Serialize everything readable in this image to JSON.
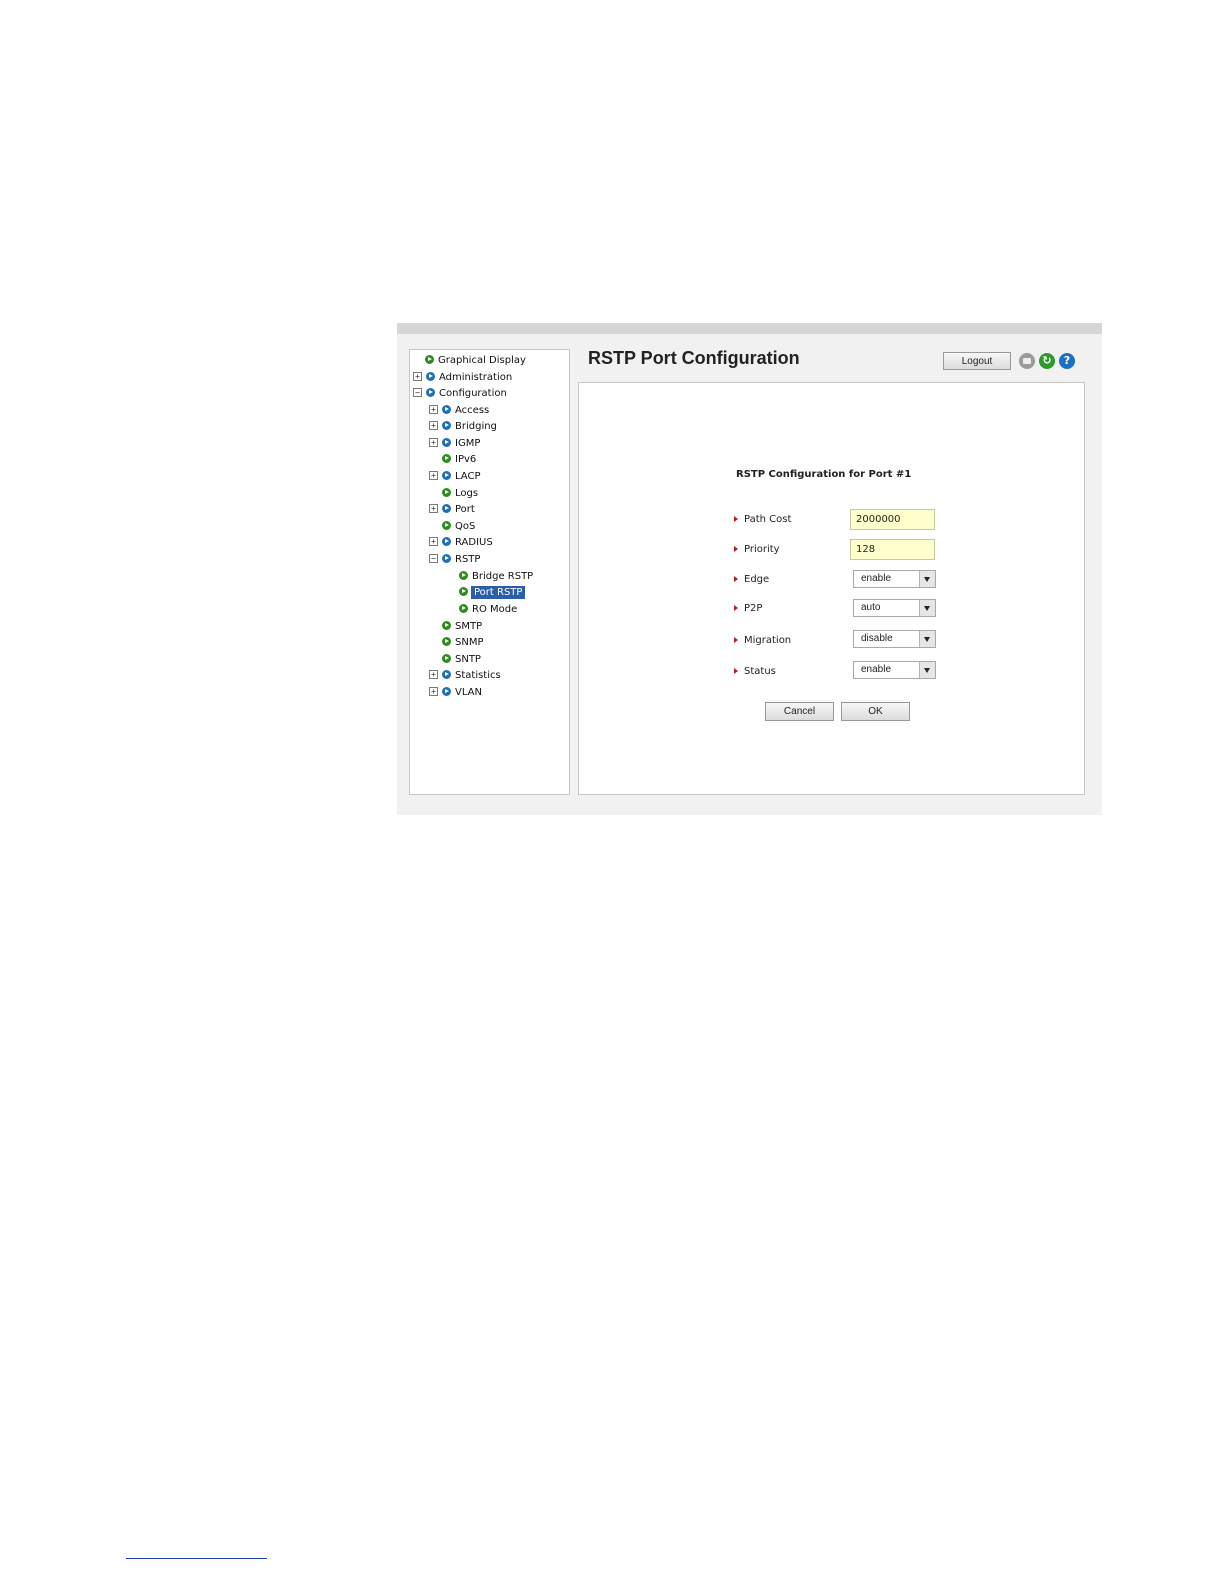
{
  "header": {
    "title": "RSTP Port Configuration",
    "logout_label": "Logout",
    "icons": [
      "print-icon",
      "refresh-icon",
      "help-icon"
    ]
  },
  "tree": {
    "items": [
      {
        "label": "Graphical Display",
        "toggle": "",
        "icon": "leaf"
      },
      {
        "label": "Administration",
        "toggle": "+",
        "icon": "folder"
      },
      {
        "label": "Configuration",
        "toggle": "−",
        "icon": "folder"
      },
      {
        "label": "Access",
        "toggle": "+",
        "icon": "folder"
      },
      {
        "label": "Bridging",
        "toggle": "+",
        "icon": "folder"
      },
      {
        "label": "IGMP",
        "toggle": "+",
        "icon": "folder"
      },
      {
        "label": "IPv6",
        "toggle": "",
        "icon": "leaf"
      },
      {
        "label": "LACP",
        "toggle": "+",
        "icon": "folder"
      },
      {
        "label": "Logs",
        "toggle": "",
        "icon": "leaf"
      },
      {
        "label": "Port",
        "toggle": "+",
        "icon": "folder"
      },
      {
        "label": "QoS",
        "toggle": "",
        "icon": "leaf"
      },
      {
        "label": "RADIUS",
        "toggle": "+",
        "icon": "folder"
      },
      {
        "label": "RSTP",
        "toggle": "−",
        "icon": "folder"
      },
      {
        "label": "Bridge RSTP",
        "toggle": "",
        "icon": "leaf"
      },
      {
        "label": "Port RSTP",
        "toggle": "",
        "icon": "leaf",
        "selected": true
      },
      {
        "label": "RO Mode",
        "toggle": "",
        "icon": "leaf"
      },
      {
        "label": "SMTP",
        "toggle": "",
        "icon": "leaf"
      },
      {
        "label": "SNMP",
        "toggle": "",
        "icon": "leaf"
      },
      {
        "label": "SNTP",
        "toggle": "",
        "icon": "leaf"
      },
      {
        "label": "Statistics",
        "toggle": "+",
        "icon": "folder"
      },
      {
        "label": "VLAN",
        "toggle": "+",
        "icon": "folder"
      }
    ]
  },
  "form": {
    "section_title": "RSTP Configuration for Port #1",
    "path_cost": {
      "label": "Path Cost",
      "value": "2000000"
    },
    "priority": {
      "label": "Priority",
      "value": "128"
    },
    "edge": {
      "label": "Edge",
      "value": "enable"
    },
    "p2p": {
      "label": "P2P",
      "value": "auto"
    },
    "migration": {
      "label": "Migration",
      "value": "disable"
    },
    "status": {
      "label": "Status",
      "value": "enable"
    },
    "cancel_label": "Cancel",
    "ok_label": "OK"
  },
  "colors": {
    "selection": "#2a5ea8",
    "input_bg": "#ffffcc",
    "folder_icon": "#1f6fb5",
    "leaf_icon": "#2e8b1e",
    "label_arrow": "#c01818"
  }
}
